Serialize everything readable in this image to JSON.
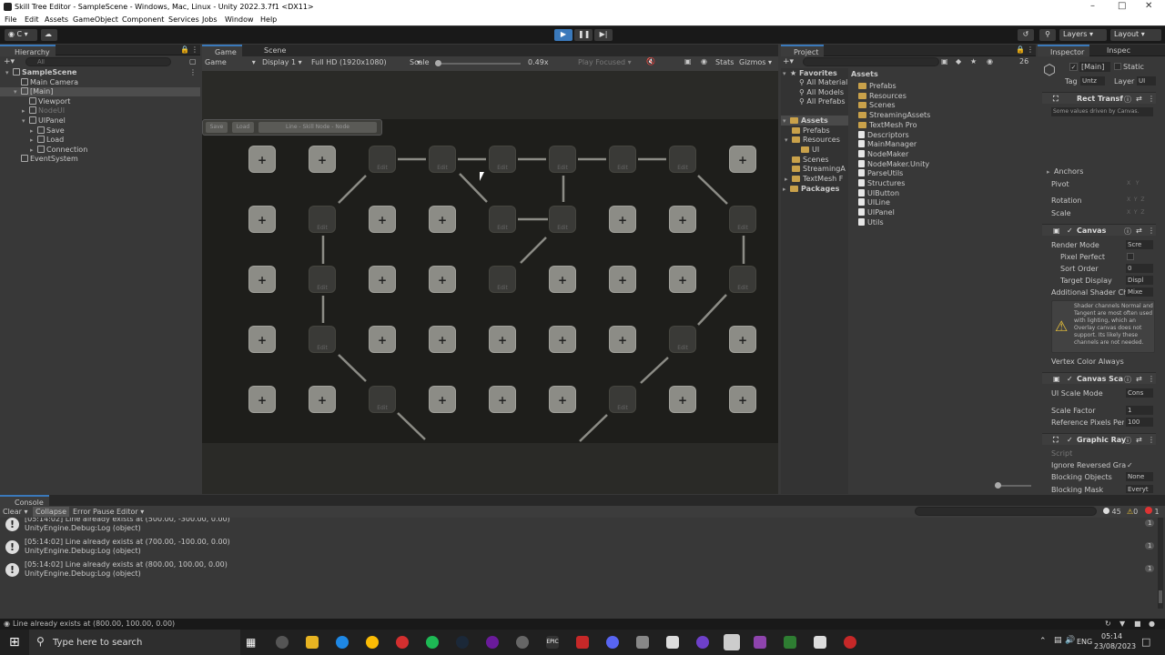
{
  "window": {
    "title": "Skill Tree Editor - SampleScene - Windows, Mac, Linux - Unity 2022.3.7f1 <DX11>"
  },
  "menu": [
    "File",
    "Edit",
    "Assets",
    "GameObject",
    "Component",
    "Services",
    "Jobs",
    "Window",
    "Help"
  ],
  "toolbar": {
    "account": "C",
    "layers": "Layers",
    "layout": "Layout"
  },
  "hierarchy": {
    "tab": "Hierarchy",
    "search_placeholder": "All",
    "items": [
      {
        "label": "SampleScene",
        "depth": 0,
        "type": "scene"
      },
      {
        "label": "Main Camera",
        "depth": 1,
        "type": "obj"
      },
      {
        "label": "[Main]",
        "depth": 1,
        "type": "obj",
        "selected": true
      },
      {
        "label": "Viewport",
        "depth": 2,
        "type": "obj"
      },
      {
        "label": "NodeUI",
        "depth": 2,
        "type": "obj",
        "disabled": true
      },
      {
        "label": "UIPanel",
        "depth": 2,
        "type": "obj"
      },
      {
        "label": "Save",
        "depth": 3,
        "type": "obj"
      },
      {
        "label": "Load",
        "depth": 3,
        "type": "obj"
      },
      {
        "label": "Connection",
        "depth": 3,
        "type": "obj"
      },
      {
        "label": "EventSystem",
        "depth": 1,
        "type": "obj"
      }
    ]
  },
  "game": {
    "tabs": [
      "Game",
      "Scene"
    ],
    "mode": "Game",
    "display": "Display 1",
    "resolution": "Full HD (1920x1080)",
    "scale_label": "Scale",
    "scale_value": "0.49x",
    "play_focused": "Play Focused",
    "stats": "Stats",
    "gizmos": "Gizmos",
    "ui_buttons": [
      "Save",
      "Load",
      "Line - Skill Node - Node"
    ],
    "node_plus": "+",
    "node_edit": "Edit",
    "grid": [
      [
        1,
        1,
        0,
        0,
        0,
        0,
        0,
        0,
        1
      ],
      [
        1,
        0,
        1,
        1,
        0,
        0,
        1,
        1,
        0
      ],
      [
        1,
        0,
        1,
        1,
        0,
        1,
        1,
        1,
        0
      ],
      [
        1,
        0,
        1,
        1,
        1,
        1,
        1,
        0,
        1
      ],
      [
        1,
        1,
        0,
        1,
        1,
        1,
        0,
        1,
        1
      ]
    ]
  },
  "project": {
    "tab": "Project",
    "favorites_label": "Favorites",
    "favorites": [
      "All Material",
      "All Models",
      "All Prefabs"
    ],
    "tree_assets": "Assets",
    "tree": [
      "Prefabs",
      "Resources",
      "UI",
      "Scenes",
      "StreamingA",
      "TextMesh F"
    ],
    "packages": "Packages",
    "assets_header": "Assets",
    "folders": [
      "Prefabs",
      "Resources",
      "Scenes",
      "StreamingAssets",
      "TextMesh Pro"
    ],
    "scripts": [
      "Descriptors",
      "MainManager",
      "NodeMaker",
      "NodeMaker.Unity",
      "ParseUtils",
      "Structures",
      "UIButton",
      "UILine",
      "UIPanel",
      "Utils"
    ],
    "count": "26"
  },
  "inspector": {
    "tabs": [
      "Inspector",
      "Inspec"
    ],
    "object_name": "[Main]",
    "static_label": "Static",
    "tag_label": "Tag",
    "tag_value": "Untz",
    "layer_label": "Layer",
    "layer_value": "UI",
    "rect_transform": "Rect Transf",
    "rect_note": "Some values driven by Canvas.",
    "anchors": "Anchors",
    "pivot": "Pivot",
    "rotation": "Rotation",
    "scale": "Scale",
    "canvas": "Canvas",
    "render_mode_label": "Render Mode",
    "render_mode_value": "Scre",
    "pixel_perfect": "Pixel Perfect",
    "sort_order_label": "Sort Order",
    "sort_order_value": "0",
    "target_display_label": "Target Display",
    "target_display_value": "Displ",
    "add_shader_label": "Additional Shader Ch",
    "add_shader_value": "Mixe",
    "warning": "Shader channels Normal and Tangent are most often used with lighting, which an Overlay canvas does not support. Its likely these channels are not needed.",
    "vertex_color": "Vertex Color Always I",
    "canvas_scaler": "Canvas Sca",
    "ui_scale_mode_label": "UI Scale Mode",
    "ui_scale_mode_value": "Cons",
    "scale_factor_label": "Scale Factor",
    "scale_factor_value": "1",
    "ref_pixels_label": "Reference Pixels Per",
    "ref_pixels_value": "100",
    "graphic_raycaster": "Graphic Ray",
    "script_label": "Script",
    "ignore_reversed": "Ignore Reversed Gra",
    "blocking_objects_label": "Blocking Objects",
    "blocking_objects_value": "None",
    "blocking_mask_label": "Blocking Mask",
    "blocking_mask_value": "Everyt"
  },
  "console": {
    "tab": "Console",
    "clear": "Clear",
    "collapse": "Collapse",
    "error_pause": "Error Pause",
    "editor": "Editor",
    "warn_count": "45",
    "err_count": "0",
    "info_count": "1",
    "logs": [
      {
        "msg": "[05:14:02] Line already exists at (500.00, -300.00, 0.00)",
        "sub": "UnityEngine.Debug:Log (object)",
        "count": "1"
      },
      {
        "msg": "[05:14:02] Line already exists at (700.00, -100.00, 0.00)",
        "sub": "UnityEngine.Debug:Log (object)",
        "count": "1"
      },
      {
        "msg": "[05:14:02] Line already exists at (800.00, 100.00, 0.00)",
        "sub": "UnityEngine.Debug:Log (object)",
        "count": "1"
      }
    ]
  },
  "status": {
    "text": "Line already exists at (800.00, 100.00, 0.00)"
  },
  "taskbar": {
    "search_placeholder": "Type here to search",
    "lang": "ENG",
    "time": "05:14",
    "date": "23/08/2023"
  }
}
